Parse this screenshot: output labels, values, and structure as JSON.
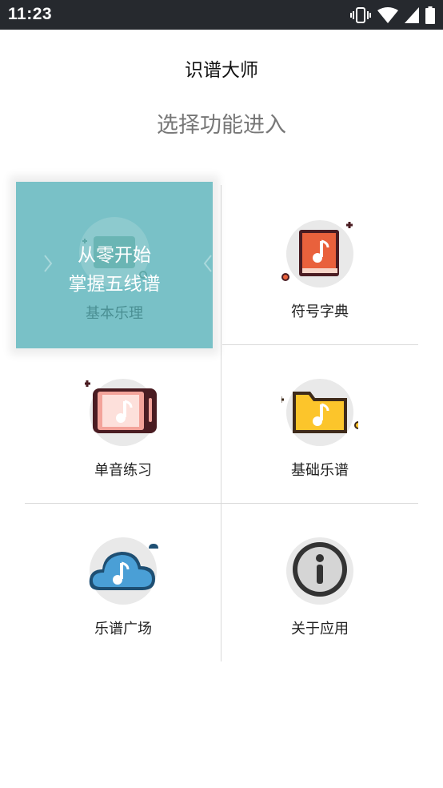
{
  "status_bar": {
    "time": "11:23",
    "icons": [
      "vibrate-icon",
      "wifi-icon",
      "signal-icon",
      "battery-icon"
    ]
  },
  "header": {
    "title": "识谱大师",
    "subtitle": "选择功能进入"
  },
  "feature_card": {
    "line1": "从零开始",
    "line2": "掌握五线谱",
    "label": "基本乐理"
  },
  "menu": {
    "items": [
      {
        "label": "符号字典",
        "icon": "music-book-icon"
      },
      {
        "label": "单音练习",
        "icon": "music-phone-icon"
      },
      {
        "label": "基础乐谱",
        "icon": "music-folder-icon"
      },
      {
        "label": "乐谱广场",
        "icon": "music-cloud-icon"
      },
      {
        "label": "关于应用",
        "icon": "info-icon"
      }
    ]
  },
  "colors": {
    "status_bar": "#26292e",
    "feature_card": "#79c1c7",
    "icon_circle": "#e9e9e9",
    "book": "#e9613c",
    "folder": "#fcc52b",
    "cloud": "#4a9fd6",
    "phone": "#f3a39a"
  }
}
